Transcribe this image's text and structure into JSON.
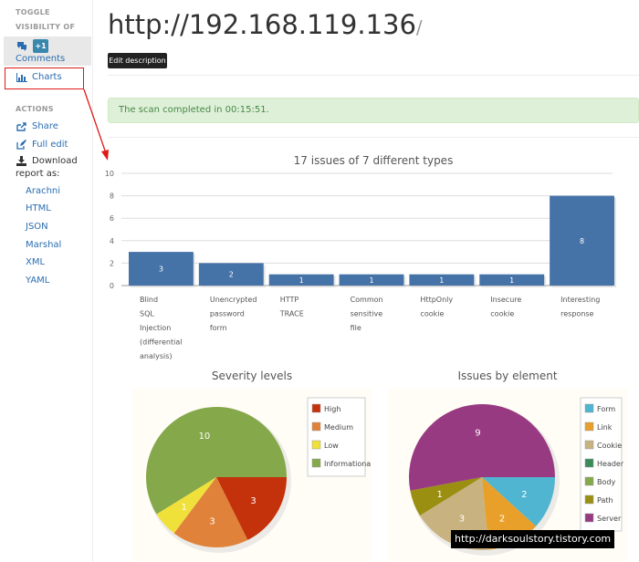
{
  "sidebar": {
    "toggle_heading_1": "TOGGLE",
    "toggle_heading_2": "VISIBILITY OF",
    "comments_badge": "+1",
    "comments_label": "Comments",
    "charts_label": "Charts",
    "actions_heading": "ACTIONS",
    "share_label": "Share",
    "full_edit_label": "Full edit",
    "download_label_1": "Download",
    "download_label_2": "report as:",
    "formats": [
      "Arachni",
      "HTML",
      "JSON",
      "Marshal",
      "XML",
      "YAML"
    ]
  },
  "header": {
    "title": "http://192.168.119.136",
    "title_suffix": "/",
    "edit_description_label": "Edit description"
  },
  "alert": {
    "message": "The scan completed in 00:15:51."
  },
  "colors": {
    "link": "#2a6db0",
    "bar": "#4572a7",
    "annotation": "#e01818"
  },
  "chart_data": [
    {
      "type": "bar",
      "title": "17 issues of 7 different types",
      "categories": [
        [
          "Blind",
          "SQL",
          "Injection",
          "(differential",
          "analysis)"
        ],
        [
          "Unencrypted",
          "password",
          "form"
        ],
        [
          "HTTP",
          "TRACE"
        ],
        [
          "Common",
          "sensitive",
          "file"
        ],
        [
          "HttpOnly",
          "cookie"
        ],
        [
          "Insecure",
          "cookie"
        ],
        [
          "Interesting",
          "response"
        ]
      ],
      "values": [
        3,
        2,
        1,
        1,
        1,
        1,
        8
      ],
      "ylim": [
        0,
        10
      ],
      "yticks": [
        0,
        2,
        4,
        6,
        8,
        10
      ],
      "color": "#4572a7"
    },
    {
      "type": "pie",
      "title": "Severity levels",
      "labels": [
        "High",
        "Medium",
        "Low",
        "Informational"
      ],
      "values": [
        3,
        3,
        1,
        10
      ],
      "colors": [
        "#c4320c",
        "#e0823a",
        "#f0e03a",
        "#84a84a"
      ]
    },
    {
      "type": "pie",
      "title": "Issues by element",
      "labels": [
        "Form",
        "Link",
        "Cookie",
        "Header",
        "Body",
        "Path",
        "Server"
      ],
      "values": [
        2,
        2,
        3,
        0,
        0,
        1,
        9
      ],
      "colors": [
        "#4fb5d0",
        "#e8a02a",
        "#c8b380",
        "#3a8a5a",
        "#84a84a",
        "#9a8f10",
        "#983a82"
      ]
    }
  ],
  "watermark": "http://darksoulstory.tistory.com"
}
